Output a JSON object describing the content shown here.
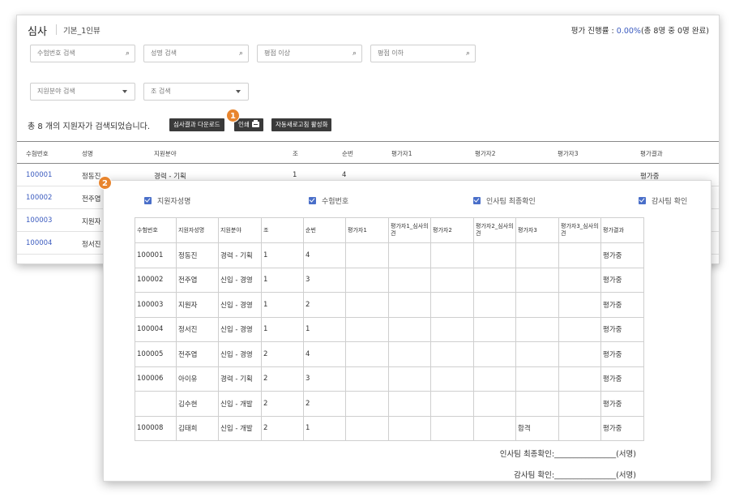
{
  "back": {
    "title": "심사",
    "subtitle": "기본_1인뷰",
    "progress_label": "평가 진행률 :",
    "progress_pct": "0.00%",
    "progress_detail": "(총 8명 중 0명 완료)",
    "search": {
      "exam_no": "수험번호 검색",
      "name": "성명 검색",
      "score_min": "평점 이상",
      "score_max": "평점 이하",
      "field": "지원분야 검색",
      "group": "조 검색"
    },
    "count_text": "총 8 개의 지원자가 검색되었습니다.",
    "buttons": {
      "download": "심사결과 다운로드",
      "print": "인쇄",
      "auto_refresh": "자동새로고침 활성화"
    },
    "columns": [
      "수험번호",
      "성명",
      "지원분야",
      "조",
      "순번",
      "평가자1",
      "평가자2",
      "평가자3",
      "평가결과"
    ],
    "rows": [
      {
        "id": "100001",
        "name": "정동진",
        "field": "경력 - 기획",
        "group": "1",
        "order": "4",
        "result": "평가중"
      },
      {
        "id": "100002",
        "name": "전주엽"
      },
      {
        "id": "100003",
        "name": "지원자"
      },
      {
        "id": "100004",
        "name": "정서진"
      }
    ]
  },
  "badges": {
    "one": "1",
    "two": "2"
  },
  "front": {
    "checks": [
      "지원자성명",
      "수험번호",
      "인사팀 최종확인",
      "감사팀 확인"
    ],
    "columns": [
      "수험번호",
      "지원자성명",
      "지원분야",
      "조",
      "순번",
      "평가자1",
      "평가자1_심사의견",
      "평가자2",
      "평가자2_심사의견",
      "평가자3",
      "평가자3_심사의견",
      "평가결과"
    ],
    "rows": [
      [
        "100001",
        "정동진",
        "경력 - 기획",
        "1",
        "4",
        "",
        "",
        "",
        "",
        "",
        "",
        "평가중"
      ],
      [
        "100002",
        "전주엽",
        "신입 - 경영",
        "1",
        "3",
        "",
        "",
        "",
        "",
        "",
        "",
        "평가중"
      ],
      [
        "100003",
        "지원자",
        "신입 - 경영",
        "1",
        "2",
        "",
        "",
        "",
        "",
        "",
        "",
        "평가중"
      ],
      [
        "100004",
        "정서진",
        "신입 - 경영",
        "1",
        "1",
        "",
        "",
        "",
        "",
        "",
        "",
        "평가중"
      ],
      [
        "100005",
        "전주엽",
        "신입 - 경영",
        "2",
        "4",
        "",
        "",
        "",
        "",
        "",
        "",
        "평가중"
      ],
      [
        "100006",
        "아이유",
        "경력 - 기획",
        "2",
        "3",
        "",
        "",
        "",
        "",
        "",
        "",
        "평가중"
      ],
      [
        "",
        "김수현",
        "신입 - 개발",
        "2",
        "2",
        "",
        "",
        "",
        "",
        "",
        "",
        "평가중"
      ],
      [
        "100008",
        "김태희",
        "신입 - 개발",
        "2",
        "1",
        "",
        "",
        "",
        "",
        "합격",
        "",
        "평가중"
      ]
    ],
    "sign_hr": "인사팀 최종확인:________________(서명)",
    "sign_audit": "감사팀 확인:________________(서명)"
  },
  "colors": {
    "accent": "#3b5bbf",
    "badge": "#e8852e",
    "button": "#3a3a3a"
  }
}
